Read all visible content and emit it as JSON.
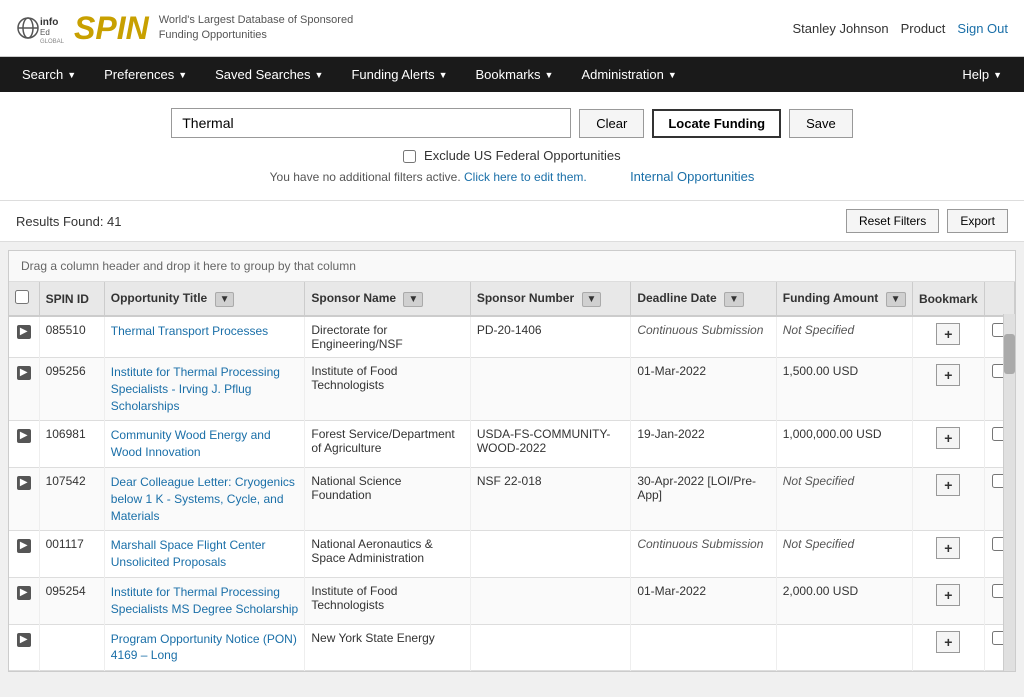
{
  "header": {
    "tagline_line1": "World's Largest Database of Sponsored",
    "tagline_line2": "Funding Opportunities",
    "user_name": "Stanley Johnson",
    "product_label": "Product",
    "signout_label": "Sign Out"
  },
  "nav": {
    "left_items": [
      {
        "label": "Search",
        "arrow": true
      },
      {
        "label": "Preferences",
        "arrow": true
      },
      {
        "label": "Saved Searches",
        "arrow": true
      },
      {
        "label": "Funding Alerts",
        "arrow": true
      },
      {
        "label": "Bookmarks",
        "arrow": true
      },
      {
        "label": "Administration",
        "arrow": true
      }
    ],
    "right_items": [
      {
        "label": "Help",
        "arrow": true
      }
    ]
  },
  "search": {
    "input_value": "Thermal",
    "input_placeholder": "",
    "clear_label": "Clear",
    "locate_label": "Locate Funding",
    "save_label": "Save",
    "exclude_label": "Exclude US Federal Opportunities",
    "filter_info": "You have no additional filters active.",
    "filter_link": "Click here to edit them.",
    "internal_opp": "Internal Opportunities"
  },
  "results": {
    "count_label": "Results Found: 41",
    "reset_label": "Reset Filters",
    "export_label": "Export"
  },
  "table": {
    "drag_hint": "Drag a column header and drop it here to group by that column",
    "columns": [
      {
        "label": "SPIN ID"
      },
      {
        "label": "Opportunity Title",
        "filter": true
      },
      {
        "label": "Sponsor Name",
        "filter": true
      },
      {
        "label": "Sponsor Number",
        "filter": true
      },
      {
        "label": "Deadline Date",
        "filter": true
      },
      {
        "label": "Funding Amount",
        "filter": true
      },
      {
        "label": "Bookmark"
      }
    ],
    "rows": [
      {
        "spin_id": "085510",
        "opp_title": "Thermal Transport Processes",
        "sponsor_name": "Directorate for Engineering/NSF",
        "sponsor_number": "PD-20-1406",
        "deadline": "Continuous Submission",
        "deadline_italic": true,
        "funding_amount": "Not Specified",
        "funding_italic": true
      },
      {
        "spin_id": "095256",
        "opp_title": "Institute for Thermal Processing Specialists - Irving J. Pflug Scholarships",
        "sponsor_name": "Institute of Food Technologists",
        "sponsor_number": "",
        "deadline": "01-Mar-2022",
        "deadline_italic": false,
        "funding_amount": "1,500.00 USD",
        "funding_italic": false
      },
      {
        "spin_id": "106981",
        "opp_title": "Community Wood Energy and Wood Innovation",
        "sponsor_name": "Forest Service/Department of Agriculture",
        "sponsor_number": "USDA-FS-COMMUNITY-WOOD-2022",
        "deadline": "19-Jan-2022",
        "deadline_italic": false,
        "funding_amount": "1,000,000.00 USD",
        "funding_italic": false
      },
      {
        "spin_id": "107542",
        "opp_title": "Dear Colleague Letter: Cryogenics below 1 K - Systems, Cycle, and Materials",
        "sponsor_name": "National Science Foundation",
        "sponsor_number": "NSF 22-018",
        "deadline": "30-Apr-2022 [LOI/Pre-App]",
        "deadline_italic": false,
        "funding_amount": "Not Specified",
        "funding_italic": true
      },
      {
        "spin_id": "001117",
        "opp_title": "Marshall Space Flight Center Unsolicited Proposals",
        "sponsor_name": "National Aeronautics & Space Administration",
        "sponsor_number": "",
        "deadline": "Continuous Submission",
        "deadline_italic": true,
        "funding_amount": "Not Specified",
        "funding_italic": true
      },
      {
        "spin_id": "095254",
        "opp_title": "Institute for Thermal Processing Specialists MS Degree Scholarship",
        "sponsor_name": "Institute of Food Technologists",
        "sponsor_number": "",
        "deadline": "01-Mar-2022",
        "deadline_italic": false,
        "funding_amount": "2,000.00 USD",
        "funding_italic": false
      },
      {
        "spin_id": "",
        "opp_title": "Program Opportunity Notice (PON) 4169 – Long",
        "sponsor_name": "New York State Energy",
        "sponsor_number": "",
        "deadline": "",
        "deadline_italic": false,
        "funding_amount": "",
        "funding_italic": false
      }
    ]
  }
}
